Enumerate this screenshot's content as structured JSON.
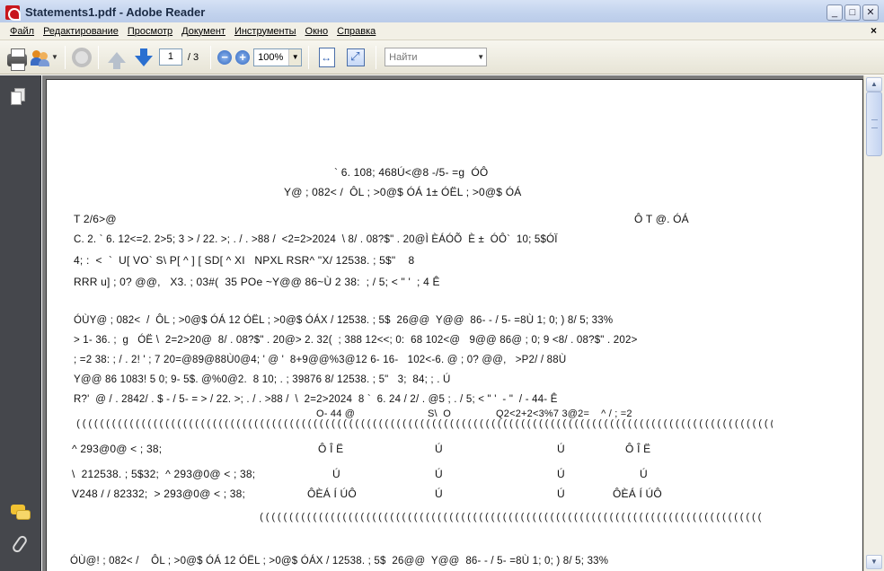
{
  "window": {
    "title": "Statements1.pdf - Adobe Reader",
    "minimize": "_",
    "maximize": "□",
    "close": "✕"
  },
  "menu": {
    "items": [
      "Файл",
      "Редактирование",
      "Просмотр",
      "Документ",
      "Инструменты",
      "Окно",
      "Справка"
    ],
    "close": "×"
  },
  "toolbar": {
    "page_current": "1",
    "page_total": "/ 3",
    "zoom_value": "100%",
    "zoom_out": "−",
    "zoom_in": "+",
    "search_placeholder": "Найти",
    "dropdown": "▼"
  },
  "scrollbar": {
    "up": "▲",
    "down": "▼"
  },
  "document": {
    "lines": [
      "` 6. 108; 468Ú<@8 -/5- =g  ÓÔ",
      "Y@ ; 082< /  ÔL ; >0@$ ÓÁ 1± ÓËL ; >0@$ ÓÁ",
      "T 2/6>@",
      "Ô T @. ÓÁ",
      "C. 2. ` 6. 12<=2. 2>5; 3 > / 22. >; . / . >88 /  <2=2>2024  \\ 8/ . 08?$\" . 20@Ì ÈÁÓÕ  È ±  ÓÔ`  10; 5$ÓÏ",
      "4; :  <  `  U[ VO` S\\ P[ ^ ] [ SD[ ^ XI   NPXL RSR^ \"X/ 12538. ; 5$\"    8",
      "RRR u] ; 0? @@,   X3. ; 03#(  35 POe ~Y@@ 86~Ù 2 38:  ; / 5; < \" '  ; 4 Ê",
      "ÓÙY@ ; 082<  /  ÔL ; >0@$ ÓÁ 12 ÓËL ; >0@$ ÓÁX / 12538. ; 5$  26@@  Y@@  86- - / 5- =8Ù 1; 0; ) 8/ 5; 33%",
      "> 1- 36. ;  g   ÓË \\  2=2>20@  8/ . 08?$\" . 20@> 2. 32(  ; 388 12<<; 0:  68 102<@   9@@ 86@ ; 0; 9 <8/ . 08?$\" . 202>",
      "; =2 38: ; / . 2! ' ; 7 20=@89@88Ù0@4; ' @ '  8+9@@%3@12 6- 16-   102<-6. @ ; 0? @@,   >P2/ / 88Ù",
      "Y@@ 86 1083! 5 0; 9- 5$. @%0@2.  8 10; . ; 39876 8/ 12538. ; 5\"   3;  84; ; . Ú",
      "R?'  @ / . 2842/ . $ - / 5- = > / 22. >; . / . >88 /  \\  2=2>2024  8 `  6. 24 / 2/ . @5 ; . / 5; < \" '  - \"  / - 44- Ê",
      "O- 44 @",
      "S\\  O",
      "Q2<2+2<3%7 3@2=    ^ / ; =2",
      "^ 293@0@ < ; 38;",
      "Ô Î Ë",
      "Ú",
      "Ú",
      "Ô Î Ë",
      "\\  212538. ; 5$32;  ^ 293@0@ < ; 38;",
      "Ú",
      "Ú",
      "Ú",
      "Ú",
      "V248 / / 82332;  > 293@0@ < ; 38;",
      "ÔÈÁ Í ÚÔ",
      "Ú",
      "Ú",
      "ÔÈÁ Í ÚÔ",
      "ÓÙ@! ; 082< /    ÔL ; >0@$ ÓÁ 12 ÓËL ; >0@$ ÓÁX / 12538. ; 5$  26@@  Y@@  86- - / 5- =8Ù 1; 0; ) 8/ 5; 33%"
    ],
    "rule_char": "(((((((((((((((((((((((((((((((((((((((((((((((((((((((((((((((((((((((((((((((((((((((((((((((((((((((((((((((((((((((((((((((((((((((((((((((((((((((((((((((((((((((((((((((((((((((((((((("
  }
}
